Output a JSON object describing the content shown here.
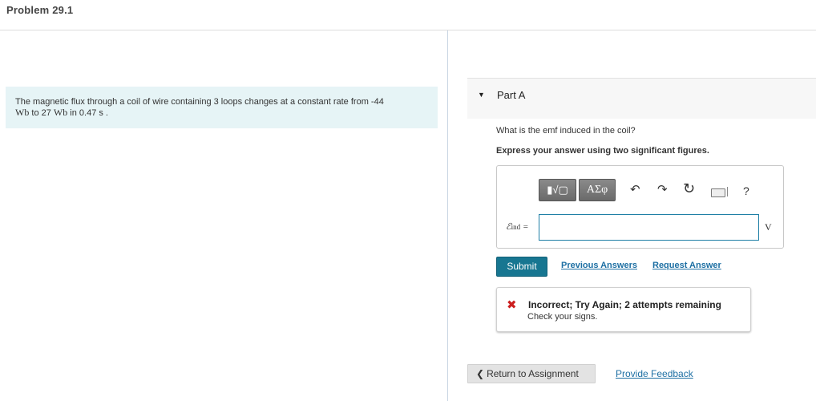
{
  "page": {
    "title": "Problem 29.1"
  },
  "problem": {
    "text_1": "The magnetic flux through a coil of wire containing 3 loops changes at a constant rate from -44",
    "flux_start_unit": "Wb",
    "text_2": " to 27 ",
    "flux_end_unit": "Wb",
    "text_3": " in 0.47 s ."
  },
  "part": {
    "caret": "▼",
    "title": "Part A",
    "question": "What is the emf induced in the coil?",
    "instruction": "Express your answer using two significant figures."
  },
  "toolbar": {
    "template_label": "▮√▢",
    "greek_label": "ΑΣφ",
    "undo_glyph": "↶",
    "redo_glyph": "↷",
    "reset_glyph": "↻",
    "help_label": "?"
  },
  "answer": {
    "symbol": "ℰ",
    "subscript": "ind",
    "equals": " =",
    "value": "",
    "unit": "V"
  },
  "actions": {
    "submit_label": "Submit",
    "previous_answers_label": "Previous Answers",
    "request_answer_label": "Request Answer"
  },
  "feedback": {
    "icon": "✖",
    "title": "Incorrect; Try Again; 2 attempts remaining",
    "message": "Check your signs.",
    "color": "#cc1f1f"
  },
  "footer": {
    "return_chevron": "❮",
    "return_label": "Return to Assignment",
    "provide_feedback_label": "Provide Feedback"
  },
  "colors": {
    "accent": "#177691",
    "link": "#1d6fa3",
    "problem_bg": "#e6f4f6"
  }
}
